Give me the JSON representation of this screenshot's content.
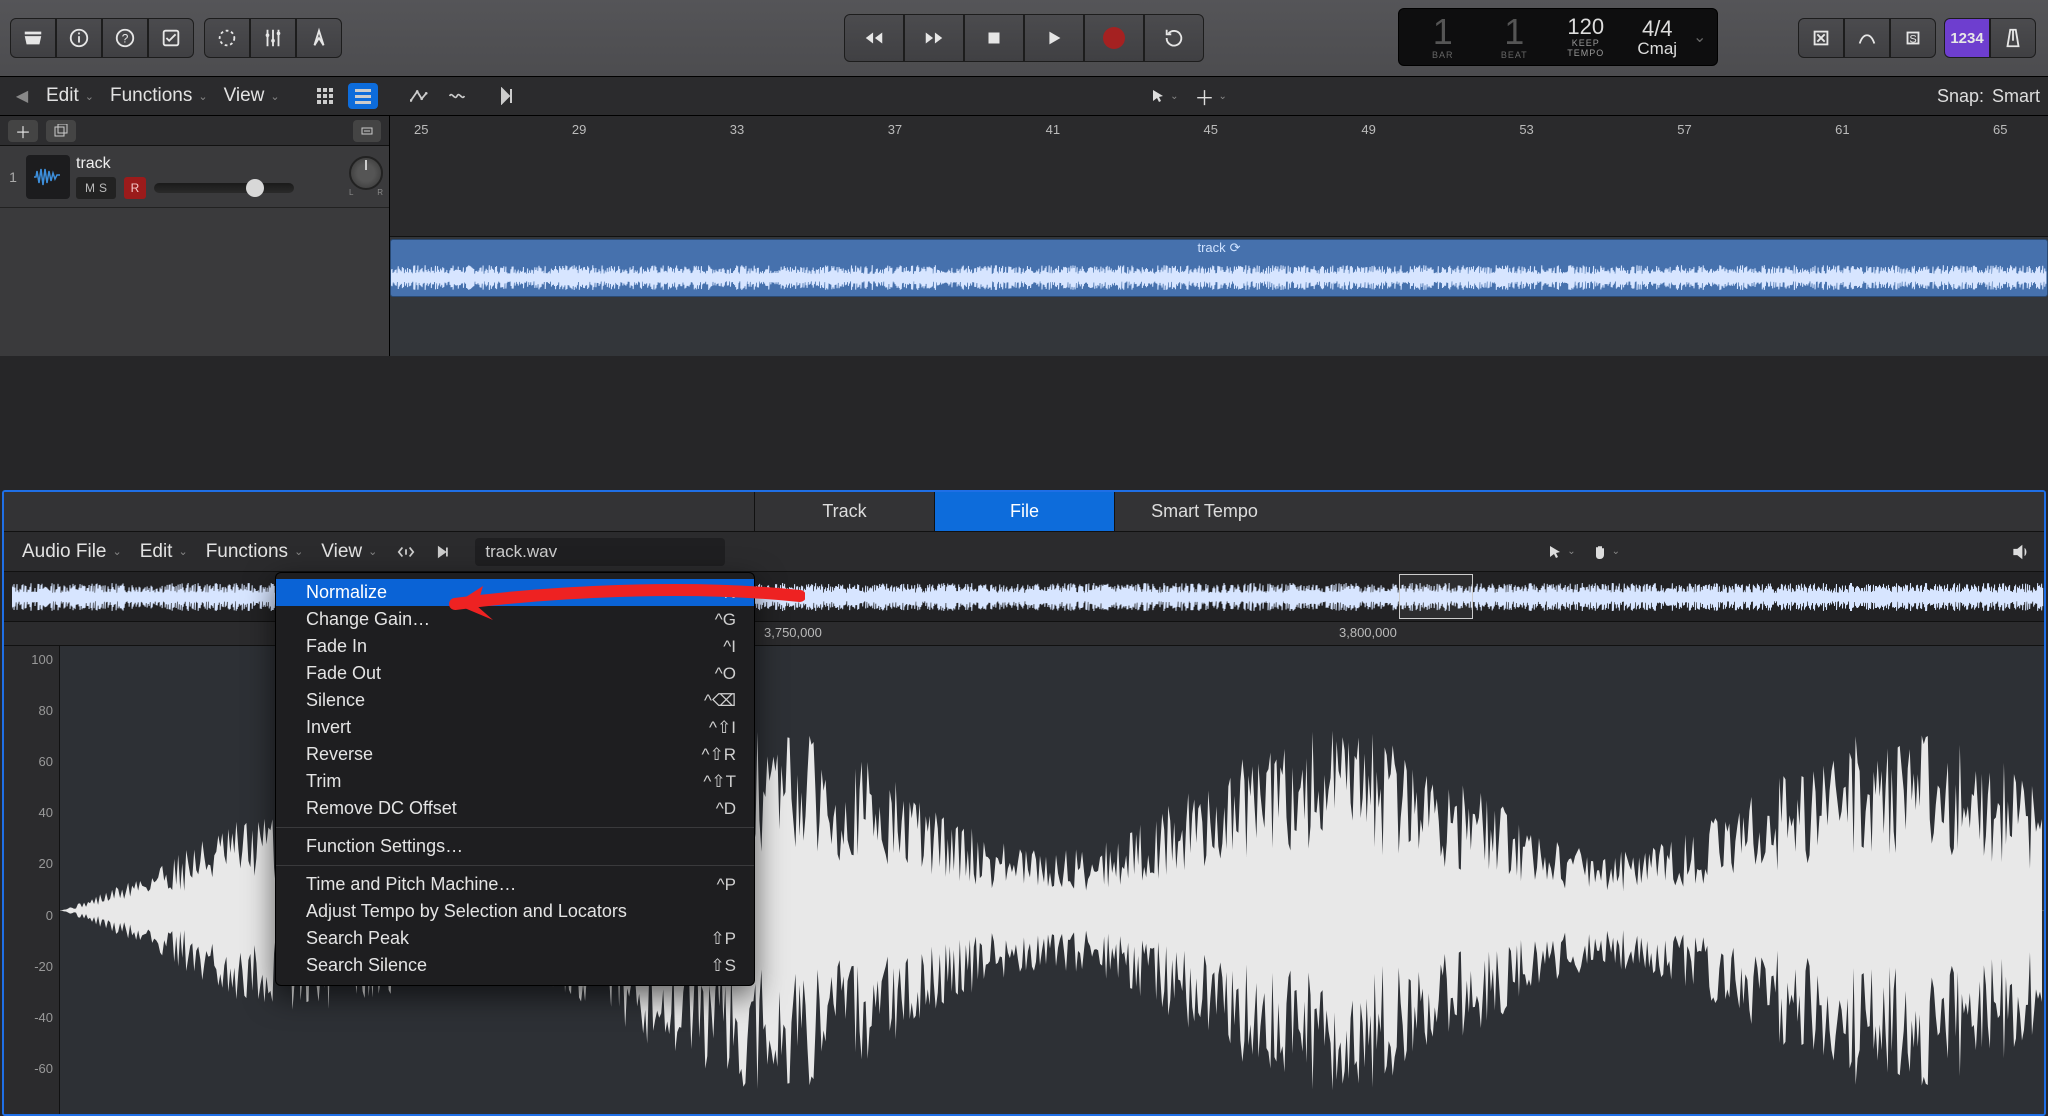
{
  "topbar": {
    "library_icon": "inbox",
    "info_icon": "info",
    "help_icon": "help",
    "notes_icon": "checkbox"
  },
  "transport": {
    "bar": "1",
    "beat": "1",
    "tempo": "120",
    "tempo_sub": "KEEP",
    "sig": "4/4",
    "key": "Cmaj",
    "bar_lbl": "BAR",
    "beat_lbl": "BEAT",
    "tempo_lbl": "TEMPO"
  },
  "right": {
    "counter": "1234"
  },
  "tracks_bar": {
    "edit": "Edit",
    "functions": "Functions",
    "view": "View",
    "snap": "Snap:",
    "snap_val": "Smart"
  },
  "ruler": {
    "marks": [
      "25",
      "29",
      "33",
      "37",
      "41",
      "45",
      "49",
      "53",
      "57",
      "61",
      "65"
    ]
  },
  "track": {
    "num": "1",
    "name": "track",
    "m": "M",
    "s": "S",
    "r": "R",
    "region_label": "track"
  },
  "editor_tabs": {
    "track": "Track",
    "file": "File",
    "smart": "Smart Tempo"
  },
  "editor_bar": {
    "audio_file": "Audio File",
    "edit": "Edit",
    "functions": "Functions",
    "view": "View",
    "filename": "track.wav"
  },
  "overview_ruler": {
    "marks": [
      "3,750,000",
      "3,800,000"
    ]
  },
  "db_marks": [
    "100",
    "80",
    "60",
    "40",
    "20",
    "0",
    "-20",
    "-40",
    "-60"
  ],
  "menu": {
    "items": [
      {
        "l": "Normalize",
        "s": "^N",
        "hl": true
      },
      {
        "l": "Change Gain…",
        "s": "^G"
      },
      {
        "l": "Fade In",
        "s": "^I"
      },
      {
        "l": "Fade Out",
        "s": "^O"
      },
      {
        "l": "Silence",
        "s": "^⌫"
      },
      {
        "l": "Invert",
        "s": "^⇧I"
      },
      {
        "l": "Reverse",
        "s": "^⇧R"
      },
      {
        "l": "Trim",
        "s": "^⇧T"
      },
      {
        "l": "Remove DC Offset",
        "s": "^D"
      },
      {
        "sep": true
      },
      {
        "l": "Function Settings…",
        "s": ""
      },
      {
        "sep": true
      },
      {
        "l": "Time and Pitch Machine…",
        "s": "^P"
      },
      {
        "l": "Adjust Tempo by Selection and Locators",
        "s": ""
      },
      {
        "l": "Search Peak",
        "s": "⇧P"
      },
      {
        "l": "Search Silence",
        "s": "⇧S"
      }
    ]
  }
}
